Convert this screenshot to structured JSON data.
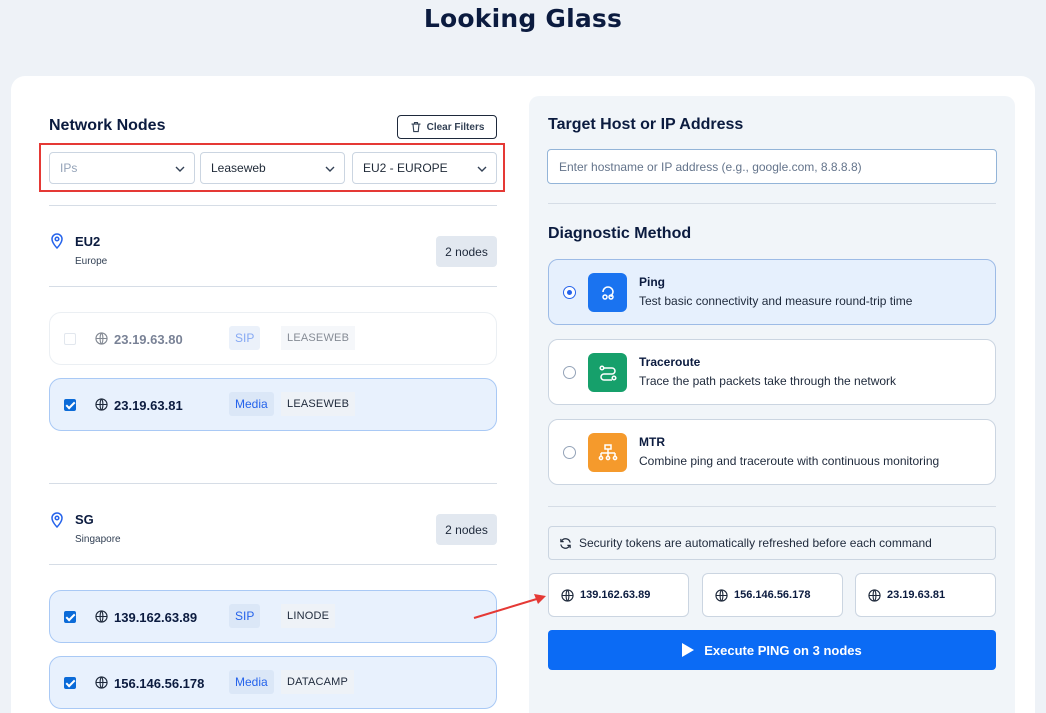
{
  "page": {
    "title": "Looking Glass"
  },
  "network": {
    "heading": "Network Nodes",
    "clear_label": "Clear Filters",
    "filters": {
      "ips": "IPs",
      "provider": "Leaseweb",
      "region": "EU2 - EUROPE"
    },
    "regions": [
      {
        "code": "EU2",
        "name": "Europe",
        "count": "2 nodes",
        "nodes": [
          {
            "ip": "23.19.63.80",
            "type": "SIP",
            "provider": "LEASEWEB",
            "checked": false,
            "disabled": true
          },
          {
            "ip": "23.19.63.81",
            "type": "Media",
            "provider": "LEASEWEB",
            "checked": true,
            "disabled": false
          }
        ]
      },
      {
        "code": "SG",
        "name": "Singapore",
        "count": "2 nodes",
        "nodes": [
          {
            "ip": "139.162.63.89",
            "type": "SIP",
            "provider": "LINODE",
            "checked": true,
            "disabled": false
          },
          {
            "ip": "156.146.56.178",
            "type": "Media",
            "provider": "DATACAMP",
            "checked": true,
            "disabled": false
          }
        ]
      }
    ]
  },
  "target": {
    "heading": "Target Host or IP Address",
    "placeholder": "Enter hostname or IP address (e.g., google.com, 8.8.8.8)"
  },
  "diagnostic": {
    "heading": "Diagnostic Method",
    "methods": [
      {
        "name": "Ping",
        "desc": "Test basic connectivity and measure round-trip time",
        "selected": true,
        "color": "#1a73f0",
        "icon": "ping-icon"
      },
      {
        "name": "Traceroute",
        "desc": "Trace the path packets take through the network",
        "selected": false,
        "color": "#16a06b",
        "icon": "route-icon"
      },
      {
        "name": "MTR",
        "desc": "Combine ping and traceroute with continuous monitoring",
        "selected": false,
        "color": "#f59a2c",
        "icon": "network-tree-icon"
      }
    ]
  },
  "security_note": "Security tokens are automatically refreshed before each command",
  "selected_nodes": [
    "139.162.63.89",
    "156.146.56.178",
    "23.19.63.81"
  ],
  "execute_label": "Execute PING on 3 nodes",
  "colors": {
    "accent": "#0b6bf5",
    "annotation": "#e53935"
  }
}
